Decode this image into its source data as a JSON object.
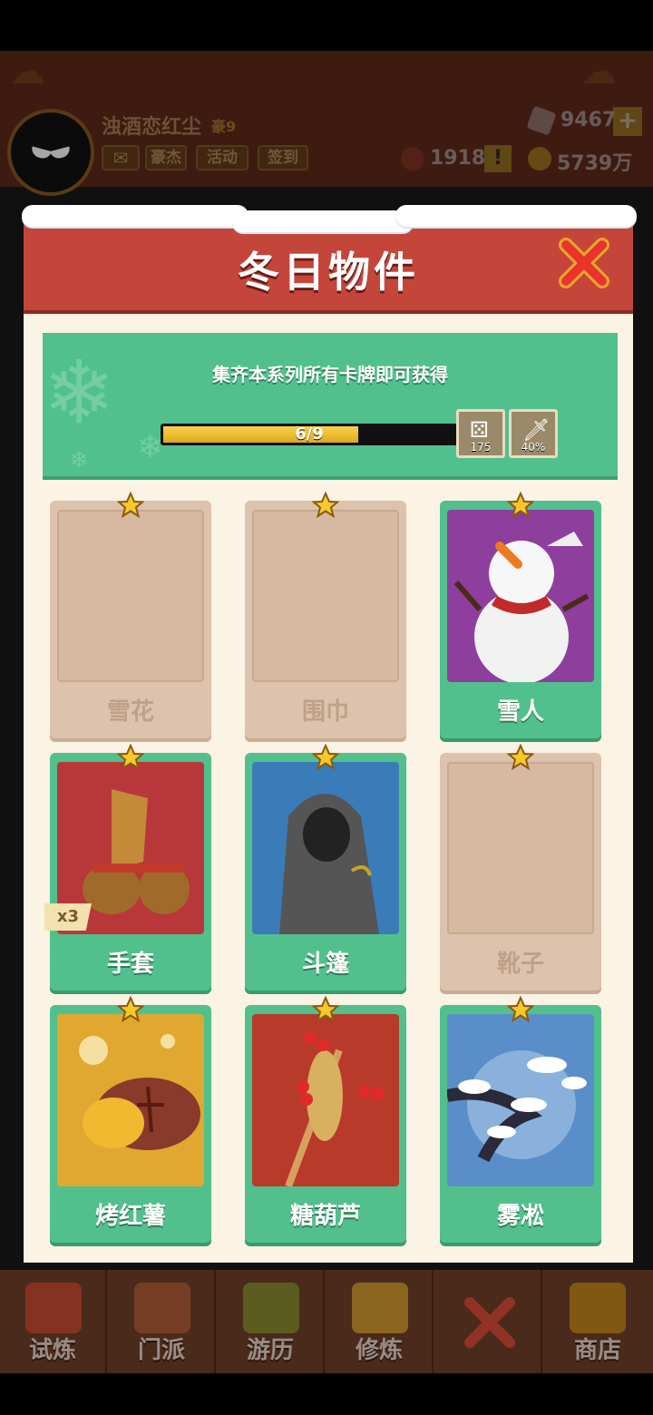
{
  "header": {
    "username": "浊酒恋红尘",
    "vip_label": "豪9",
    "buttons": [
      "豪杰",
      "活动",
      "签到"
    ],
    "gems": "9467",
    "tokens": "1918",
    "coins": "5739万",
    "plus_label": "+",
    "alert_label": "!"
  },
  "dialog": {
    "title": "冬日物件",
    "banner_text": "集齐本系列所有卡牌即可获得",
    "progress": {
      "current": 6,
      "total": 9,
      "label": "6/9"
    },
    "rewards": [
      {
        "icon": "dice-icon",
        "value": "175"
      },
      {
        "icon": "sword-icon",
        "value": "40%"
      }
    ],
    "cards": [
      {
        "name": "雪花",
        "unlocked": false,
        "art": ""
      },
      {
        "name": "围巾",
        "unlocked": false,
        "art": ""
      },
      {
        "name": "雪人",
        "unlocked": true,
        "art": "snowman"
      },
      {
        "name": "手套",
        "unlocked": true,
        "art": "gloves",
        "badge": "x3"
      },
      {
        "name": "斗篷",
        "unlocked": true,
        "art": "cloak"
      },
      {
        "name": "靴子",
        "unlocked": false,
        "art": ""
      },
      {
        "name": "烤红薯",
        "unlocked": true,
        "art": "sweetpotato"
      },
      {
        "name": "糖葫芦",
        "unlocked": true,
        "art": "candiedhaws"
      },
      {
        "name": "雾凇",
        "unlocked": true,
        "art": "rime"
      }
    ]
  },
  "nav": [
    {
      "label": "试炼",
      "color": "#c0392b"
    },
    {
      "label": "门派",
      "color": "#a0522d"
    },
    {
      "label": "游历",
      "color": "#6b8e23"
    },
    {
      "label": "修炼",
      "color": "#c9a227"
    },
    {
      "label": "",
      "color": "#c0392b"
    },
    {
      "label": "商店",
      "color": "#b8860b"
    }
  ],
  "colors": {
    "accent_green": "#52c08c",
    "header_red": "#c4463a",
    "locked": "#ddc3ad"
  }
}
